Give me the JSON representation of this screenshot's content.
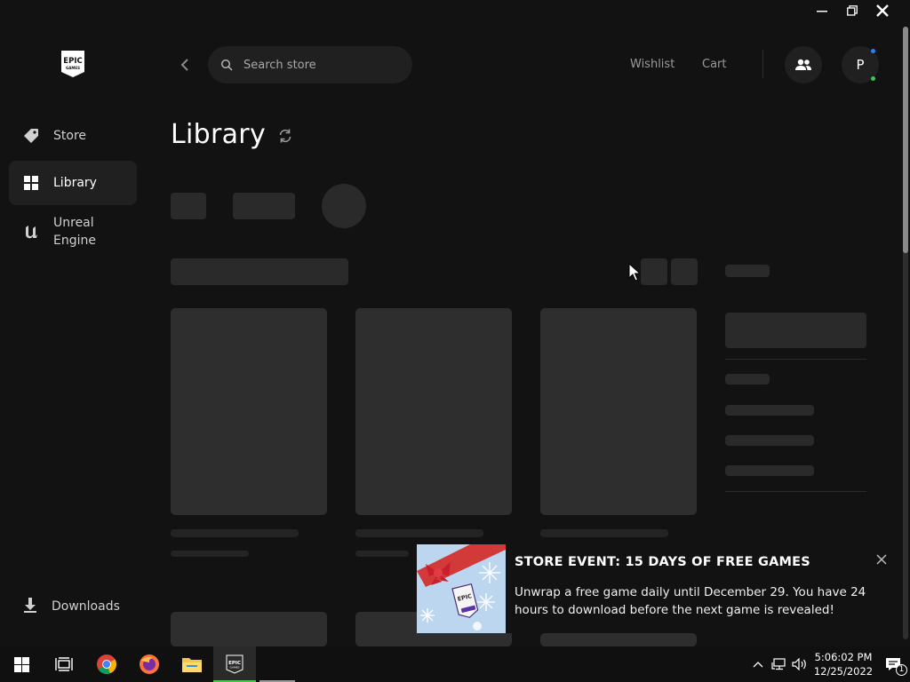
{
  "sidebar": {
    "items": [
      {
        "label": "Store",
        "icon": "tag-icon"
      },
      {
        "label": "Library",
        "icon": "grid-icon"
      },
      {
        "label": "Unreal Engine",
        "icon": "unreal-icon"
      }
    ],
    "downloads_label": "Downloads"
  },
  "header": {
    "search_placeholder": "Search store",
    "wishlist_label": "Wishlist",
    "cart_label": "Cart",
    "avatar_initial": "P"
  },
  "page": {
    "title": "Library"
  },
  "toast": {
    "title": "STORE EVENT: 15 DAYS OF FREE GAMES",
    "message": "Unwrap a free game daily until December 29. You have 24 hours to download before the next game is revealed!"
  },
  "taskbar": {
    "time": "5:06:02 PM",
    "date": "12/25/2022",
    "notification_count": "1"
  },
  "colors": {
    "background": "#121212",
    "surface": "#202020",
    "skeleton": "#2e2e2e",
    "online": "#3cc45b",
    "notify": "#2d7ff9",
    "taskbar_active": "#4fbf4f"
  }
}
